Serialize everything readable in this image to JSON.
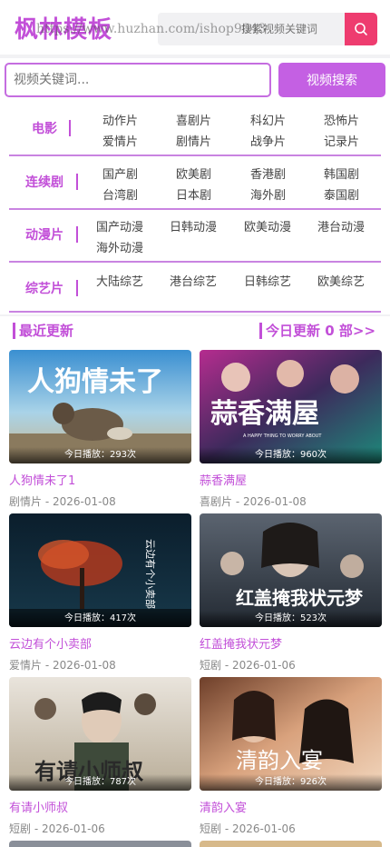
{
  "header": {
    "logo": "枫林模板",
    "search_placeholder": "搜索视频关键词",
    "watermark": "https://www.huzhan.com/ishop9043"
  },
  "search": {
    "placeholder": "视频关键词...",
    "button_label": "视频搜索"
  },
  "categories": [
    {
      "label": "电影",
      "items": [
        "动作片",
        "喜剧片",
        "科幻片",
        "恐怖片",
        "爱情片",
        "剧情片",
        "战争片",
        "记录片"
      ]
    },
    {
      "label": "连续剧",
      "items": [
        "国产剧",
        "欧美剧",
        "香港剧",
        "韩国剧",
        "台湾剧",
        "日本剧",
        "海外剧",
        "泰国剧"
      ]
    },
    {
      "label": "动漫片",
      "items": [
        "国产动漫",
        "日韩动漫",
        "欧美动漫",
        "港台动漫",
        "海外动漫"
      ]
    },
    {
      "label": "综艺片",
      "items": [
        "大陆综艺",
        "港台综艺",
        "日韩综艺",
        "欧美综艺"
      ]
    }
  ],
  "section": {
    "title": "最近更新",
    "today_prefix": "今日更新",
    "today_count": "0",
    "today_suffix": "部>>"
  },
  "videos": [
    {
      "title": "人狗情未了1",
      "genre": "剧情片",
      "date": "2026-01-08",
      "plays": "今日播放：293次",
      "poster_text": "人狗情未了"
    },
    {
      "title": "蒜香满屋",
      "genre": "喜剧片",
      "date": "2026-01-08",
      "plays": "今日播放：960次",
      "poster_text": "蒜香满屋",
      "poster_sub": "A HAPPY THING TO WORRY ABOUT"
    },
    {
      "title": "云边有个小卖部",
      "genre": "爱情片",
      "date": "2026-01-08",
      "plays": "今日播放：417次",
      "poster_text": "云边有个小卖部"
    },
    {
      "title": "红盖掩我状元梦",
      "genre": "短剧",
      "date": "2026-01-06",
      "plays": "今日播放：523次",
      "poster_text": "红盖掩我状元梦"
    },
    {
      "title": "有请小师叔",
      "genre": "短剧",
      "date": "2026-01-06",
      "plays": "今日播放：787次",
      "poster_text": "有请小师叔"
    },
    {
      "title": "清韵入宴",
      "genre": "短剧",
      "date": "2026-01-06",
      "plays": "今日播放：926次",
      "poster_text": "清韵入宴"
    }
  ],
  "colors": {
    "accent": "#c24fd8",
    "search_button": "#ee3c6f"
  },
  "icons": {
    "top_search": "search-icon"
  }
}
